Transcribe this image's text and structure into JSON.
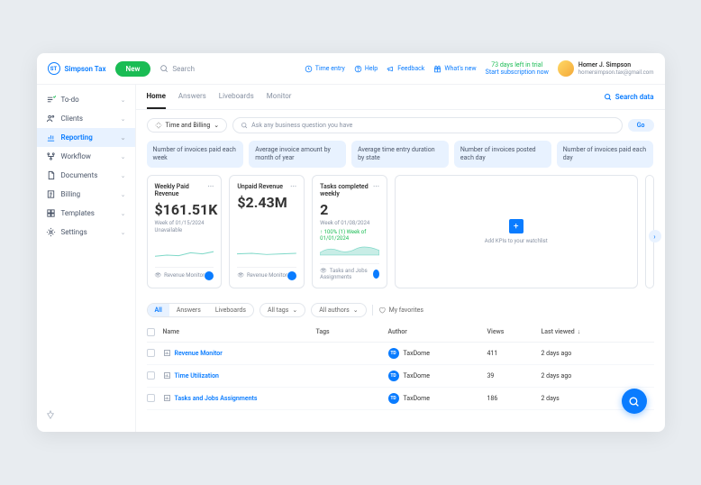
{
  "brand": {
    "abbr": "ST",
    "name": "Simpson Tax"
  },
  "topbar": {
    "new": "New",
    "search_placeholder": "Search",
    "links": {
      "time_entry": "Time entry",
      "help": "Help",
      "feedback": "Feedback",
      "whats_new": "What's new"
    },
    "trial": {
      "line1": "73 days left in trial",
      "line2": "Start subscription now"
    },
    "user": {
      "name": "Homer J. Simpson",
      "email": "homersimpson.tax@gmail.com"
    }
  },
  "sidebar": {
    "items": [
      {
        "icon": "check",
        "label": "To-do"
      },
      {
        "icon": "users",
        "label": "Clients"
      },
      {
        "icon": "chart",
        "label": "Reporting",
        "active": true
      },
      {
        "icon": "flow",
        "label": "Workflow"
      },
      {
        "icon": "doc",
        "label": "Documents"
      },
      {
        "icon": "bill",
        "label": "Billing"
      },
      {
        "icon": "tmpl",
        "label": "Templates"
      },
      {
        "icon": "gear",
        "label": "Settings"
      }
    ]
  },
  "tabs": {
    "items": [
      "Home",
      "Answers",
      "Liveboards",
      "Monitor"
    ],
    "active": 0,
    "search_data": "Search data"
  },
  "ask": {
    "category": "Time and Billing",
    "placeholder": "Ask any business question you have",
    "go": "Go"
  },
  "suggestions": [
    "Number of invoices paid each week",
    "Average invoice amount by month of year",
    "Average time entry duration by state",
    "Number of invoices posted each day",
    "Number of invoices paid each day"
  ],
  "kpis": [
    {
      "title": "Weekly Paid Revenue",
      "value": "$161.51K",
      "sub": "Week of 01/15/2024",
      "sub2": "Unavailable",
      "footer": "Revenue Monitor"
    },
    {
      "title": "Unpaid Revenue",
      "value": "$2.43M",
      "sub": "",
      "sub2": "",
      "footer": "Revenue Monitor"
    },
    {
      "title": "Tasks completed weekly",
      "value": "2",
      "sub": "Week of 01/08/2024",
      "trend": "↑ 100% (1) Week of 01/01/2024",
      "footer": "Tasks and Jobs Assignments"
    }
  ],
  "add_card": "Add KPIs to your watchlist",
  "filters": {
    "seg": [
      "All",
      "Answers",
      "Liveboards"
    ],
    "seg_active": 0,
    "all_tags": "All tags",
    "all_authors": "All authors",
    "favs": "My favorites"
  },
  "table": {
    "headers": {
      "name": "Name",
      "tags": "Tags",
      "author": "Author",
      "views": "Views",
      "last": "Last viewed"
    },
    "author_abbr": "TD",
    "rows": [
      {
        "name": "Revenue Monitor",
        "author": "TaxDome",
        "views": "411",
        "last": "2 days ago"
      },
      {
        "name": "Time Utilization",
        "author": "TaxDome",
        "views": "39",
        "last": "2 days ago"
      },
      {
        "name": "Tasks and Jobs Assignments",
        "author": "TaxDome",
        "views": "186",
        "last": "2 days"
      }
    ]
  }
}
